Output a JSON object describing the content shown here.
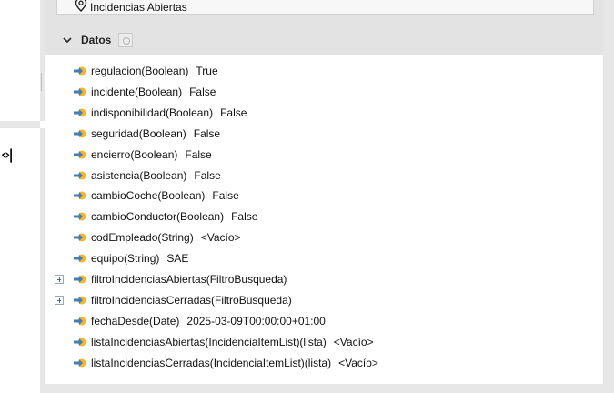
{
  "left": {
    "last_page_glyph": "‹›|"
  },
  "top_item": {
    "label": "Incidencias Abiertas",
    "icon": "location-pin-icon"
  },
  "section": {
    "title": "Datos",
    "collapse_icon": "chevron-down-icon",
    "settings_icon": "settings-icon"
  },
  "properties": [
    {
      "name": "regulacion(Boolean)",
      "value": "True",
      "expandable": false,
      "icon": "property-arrow-icon"
    },
    {
      "name": "incidente(Boolean)",
      "value": "False",
      "expandable": false,
      "icon": "property-arrow-icon"
    },
    {
      "name": "indisponibilidad(Boolean)",
      "value": "False",
      "expandable": false,
      "icon": "property-arrow-icon"
    },
    {
      "name": "seguridad(Boolean)",
      "value": "False",
      "expandable": false,
      "icon": "property-arrow-icon"
    },
    {
      "name": "encierro(Boolean)",
      "value": "False",
      "expandable": false,
      "icon": "property-arrow-icon"
    },
    {
      "name": "asistencia(Boolean)",
      "value": "False",
      "expandable": false,
      "icon": "property-arrow-icon"
    },
    {
      "name": "cambioCoche(Boolean)",
      "value": "False",
      "expandable": false,
      "icon": "property-arrow-icon"
    },
    {
      "name": "cambioConductor(Boolean)",
      "value": "False",
      "expandable": false,
      "icon": "property-arrow-icon"
    },
    {
      "name": "codEmpleado(String)",
      "value": "<Vacío>",
      "expandable": false,
      "icon": "property-arrow-icon"
    },
    {
      "name": "equipo(String)",
      "value": "SAE",
      "expandable": false,
      "icon": "property-arrow-icon"
    },
    {
      "name": "filtroIncidenciasAbiertas(FiltroBusqueda)",
      "value": "",
      "expandable": true,
      "icon": "property-arrow-icon"
    },
    {
      "name": "filtroIncidenciasCerradas(FiltroBusqueda)",
      "value": "",
      "expandable": true,
      "icon": "property-arrow-icon"
    },
    {
      "name": "fechaDesde(Date)",
      "value": "2025-03-09T00:00:00+01:00",
      "expandable": false,
      "icon": "property-arrow-icon"
    },
    {
      "name": "listaIncidenciasAbiertas(IncidenciaItemList)(lista)",
      "value": "<Vacío>",
      "expandable": false,
      "icon": "property-arrow-icon"
    },
    {
      "name": "listaIncidenciasCerradas(IncidenciaItemList)(lista)",
      "value": "<Vacío>",
      "expandable": false,
      "icon": "property-arrow-icon"
    }
  ],
  "colors": {
    "header_bg": "#e3e3e3",
    "icon_yellow": "#f2b630",
    "icon_blue": "#3f7fbf"
  }
}
